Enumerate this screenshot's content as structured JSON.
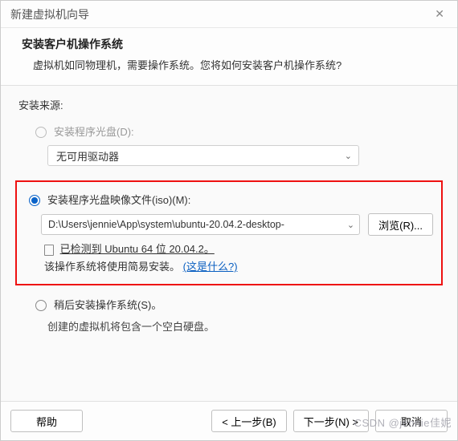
{
  "titlebar": {
    "title": "新建虚拟机向导"
  },
  "header": {
    "title": "安装客户机操作系统",
    "subtitle": "虚拟机如同物理机，需要操作系统。您将如何安装客户机操作系统?"
  },
  "body": {
    "source_label": "安装来源:",
    "opt_disc": {
      "label": "安装程序光盘(D):",
      "dropdown_value": "无可用驱动器"
    },
    "opt_iso": {
      "label": "安装程序光盘映像文件(iso)(M):",
      "path_value": "D:\\Users\\jennie\\App\\system\\ubuntu-20.04.2-desktop-",
      "browse_label": "浏览(R)...",
      "detected_line": "已检测到 Ubuntu 64 位 20.04.2。",
      "easy_install_line": "该操作系统将使用简易安装。",
      "whats_this": "(这是什么?)"
    },
    "opt_later": {
      "label": "稍后安装操作系统(S)。",
      "note": "创建的虚拟机将包含一个空白硬盘。"
    }
  },
  "footer": {
    "help": "帮助",
    "back": "< 上一步(B)",
    "next": "下一步(N) >",
    "cancel": "取消"
  },
  "watermark": "CSDN @jennie佳妮"
}
